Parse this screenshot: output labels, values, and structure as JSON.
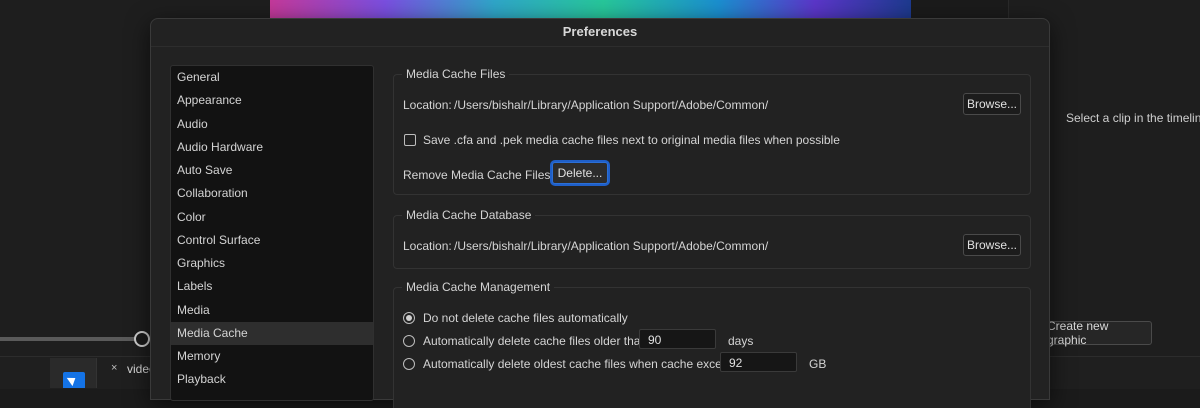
{
  "dialog": {
    "title": "Preferences"
  },
  "sidebar": {
    "items": [
      {
        "label": "General"
      },
      {
        "label": "Appearance"
      },
      {
        "label": "Audio"
      },
      {
        "label": "Audio Hardware"
      },
      {
        "label": "Auto Save"
      },
      {
        "label": "Collaboration"
      },
      {
        "label": "Color"
      },
      {
        "label": "Control Surface"
      },
      {
        "label": "Graphics"
      },
      {
        "label": "Labels"
      },
      {
        "label": "Media"
      },
      {
        "label": "Media Cache"
      },
      {
        "label": "Memory"
      },
      {
        "label": "Playback"
      }
    ],
    "selected": "Media Cache"
  },
  "media_cache_files": {
    "title": "Media Cache Files",
    "location_label": "Location:",
    "location_path": "/Users/bishalr/Library/Application Support/Adobe/Common/",
    "browse_label": "Browse...",
    "save_checkbox_label": "Save .cfa and .pek media cache files next to original media files when possible",
    "save_checkbox_checked": false,
    "remove_label": "Remove Media Cache Files",
    "delete_label": "Delete..."
  },
  "media_cache_database": {
    "title": "Media Cache Database",
    "location_label": "Location:",
    "location_path": "/Users/bishalr/Library/Application Support/Adobe/Common/",
    "browse_label": "Browse..."
  },
  "media_cache_management": {
    "title": "Media Cache Management",
    "option_no_delete": "Do not delete cache files automatically",
    "option_older_than": "Automatically delete cache files older than:",
    "older_than_value": "90",
    "older_than_unit": "days",
    "option_exceeds": "Automatically delete oldest cache files when cache exceeds:",
    "exceeds_value": "92",
    "exceeds_unit": "GB",
    "selected_option": "Do not delete cache files automatically"
  },
  "background": {
    "select_clip_text": "Select a clip in the timeline to",
    "create_graphic_label": "Create new graphic",
    "tab_close": "×",
    "tab_label": "video"
  },
  "colors": {
    "accent_focus": "#2b6fd6",
    "dialog_bg": "#222222",
    "list_bg": "#121212"
  }
}
